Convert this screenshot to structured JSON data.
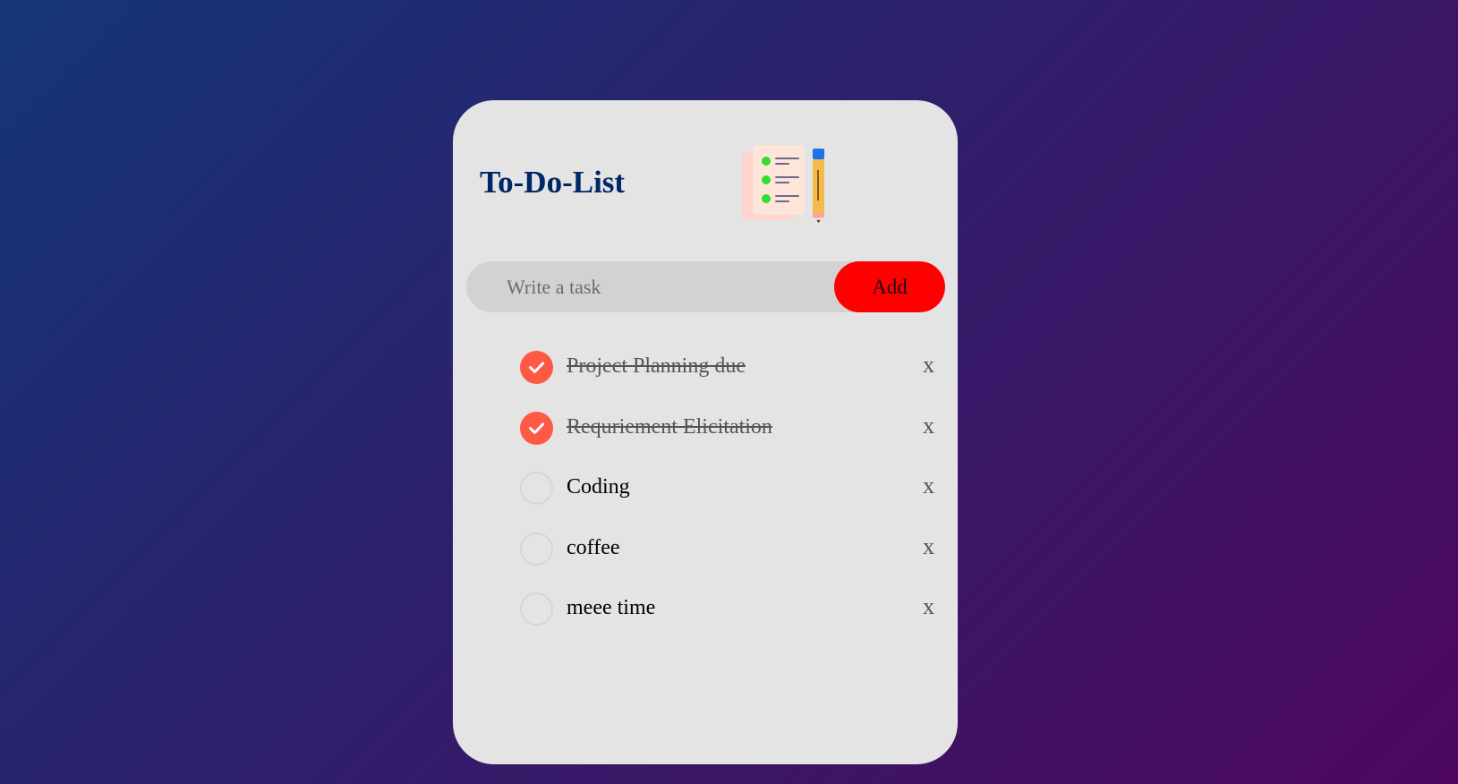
{
  "app": {
    "title": "To-Do-List",
    "logo_icon": "checklist-notepad-pencil-icon"
  },
  "input": {
    "placeholder": "Write a task",
    "value": ""
  },
  "add_button": {
    "label": "Add"
  },
  "colors": {
    "title": "#002765",
    "add_button": "#ff0000",
    "checked": "#ff5945",
    "card": "#e4e4e4",
    "input_bg": "#d2d2d2",
    "background_gradient": [
      "#153677",
      "#4e085f"
    ]
  },
  "tasks": [
    {
      "text": "Project Planning due",
      "checked": true,
      "delete_label": "x"
    },
    {
      "text": "Requriement Elicitation",
      "checked": true,
      "delete_label": "x"
    },
    {
      "text": "Coding",
      "checked": false,
      "delete_label": "x"
    },
    {
      "text": "coffee",
      "checked": false,
      "delete_label": "x"
    },
    {
      "text": "meee time",
      "checked": false,
      "delete_label": "x"
    }
  ]
}
